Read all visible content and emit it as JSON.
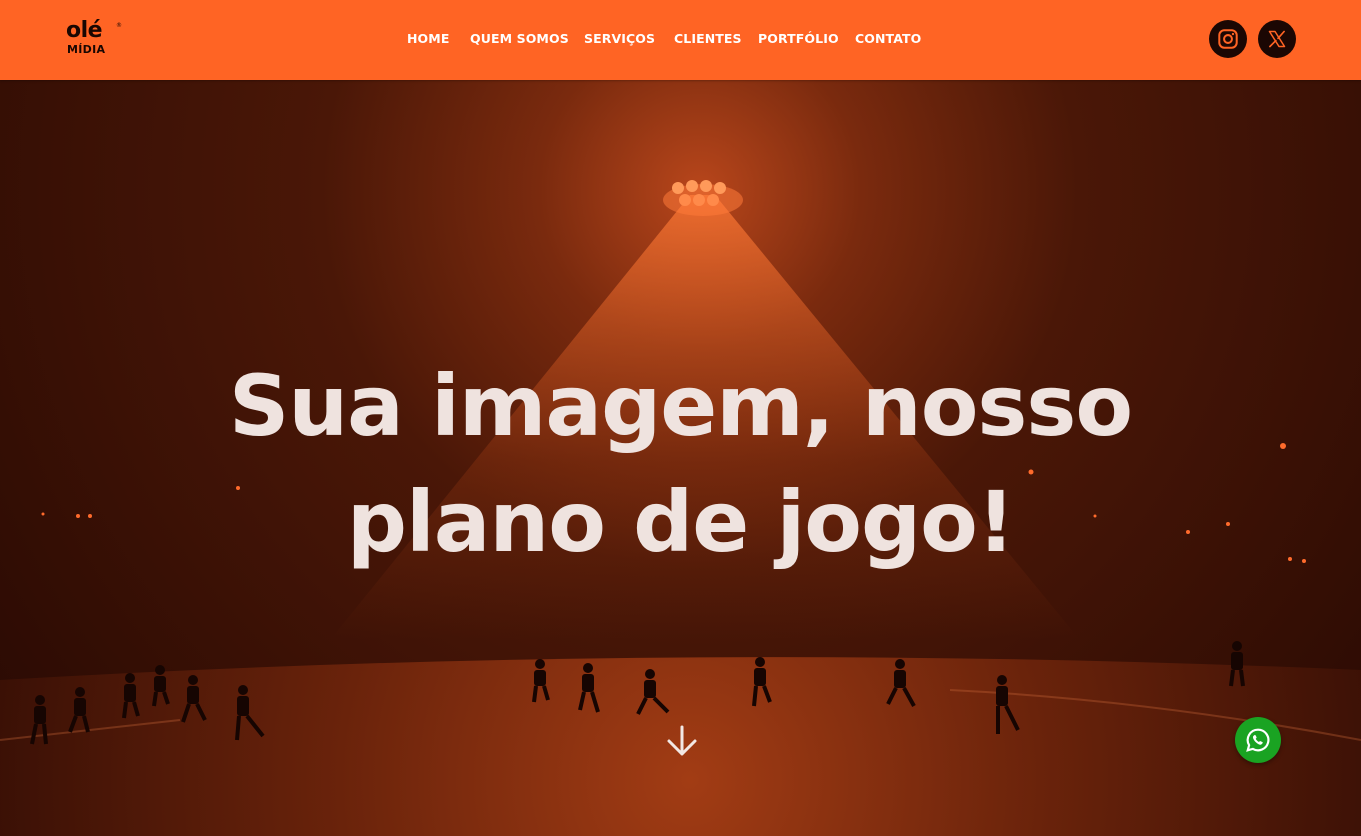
{
  "brand": {
    "line1": "olé",
    "line2": "MÍDIA",
    "reg": "®"
  },
  "nav": [
    {
      "label": "HOME"
    },
    {
      "label": "QUEM SOMOS"
    },
    {
      "label": "SERVIÇOS"
    },
    {
      "label": "CLIENTES"
    },
    {
      "label": "PORTFÓLIO"
    },
    {
      "label": "CONTATO"
    }
  ],
  "social": {
    "instagram_icon": "instagram-icon",
    "x_icon": "x-logo-icon"
  },
  "hero": {
    "headline_line1": "Sua imagem, nosso",
    "headline_line2": "plano de jogo!",
    "scroll_icon": "arrow-down-icon"
  },
  "floating": {
    "whatsapp_icon": "whatsapp-icon"
  },
  "colors": {
    "header_bg": "#ff6424",
    "hero_dark": "#2a0a03",
    "light_glow": "#ff6a2a",
    "headline": "#efe3df",
    "whatsapp": "#1aa322"
  }
}
